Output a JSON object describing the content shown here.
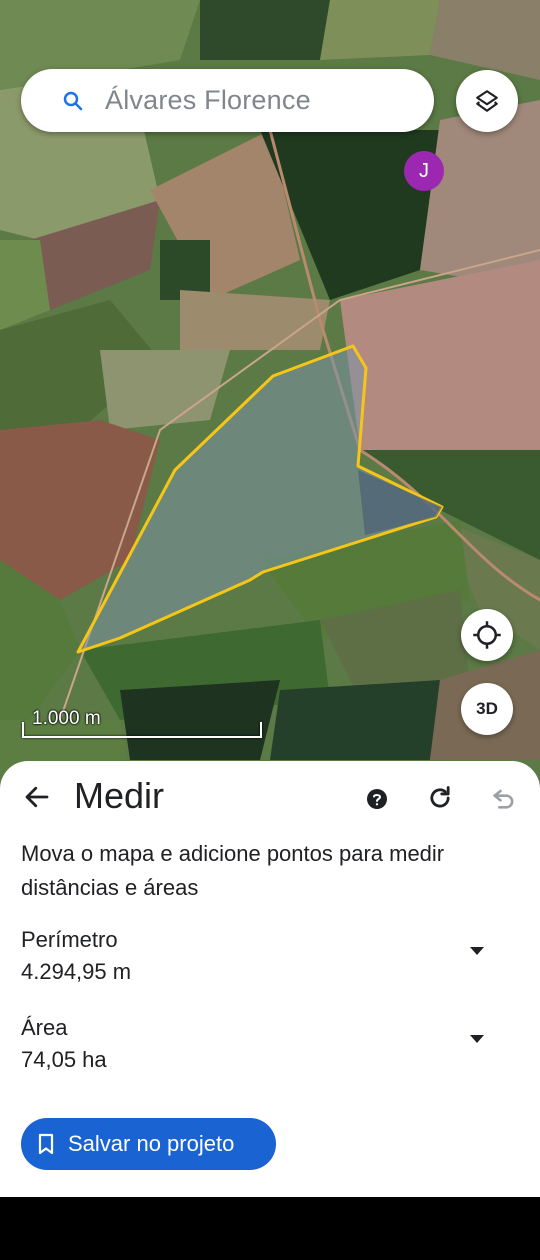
{
  "map": {
    "search_text": "Álvares Florence",
    "avatar_initial": "J",
    "scale_label": "1.000 m",
    "btn_3d_label": "3D",
    "polygon_color": "#f5c518"
  },
  "sheet": {
    "title": "Medir",
    "instructions": "Mova o mapa e adicione pontos para medir distâncias e áreas",
    "perimeter_label": "Perímetro",
    "perimeter_value": "4.294,95 m",
    "area_label": "Área",
    "area_value": "74,05 ha",
    "save_label": "Salvar no projeto"
  },
  "colors": {
    "accent": "#1a63d3",
    "avatar": "#9c27b0"
  },
  "icons": [
    "search-icon",
    "layers-icon",
    "locate-icon",
    "back-arrow-icon",
    "help-icon",
    "refresh-icon",
    "undo-icon",
    "dropdown-icon",
    "bookmark-icon"
  ]
}
